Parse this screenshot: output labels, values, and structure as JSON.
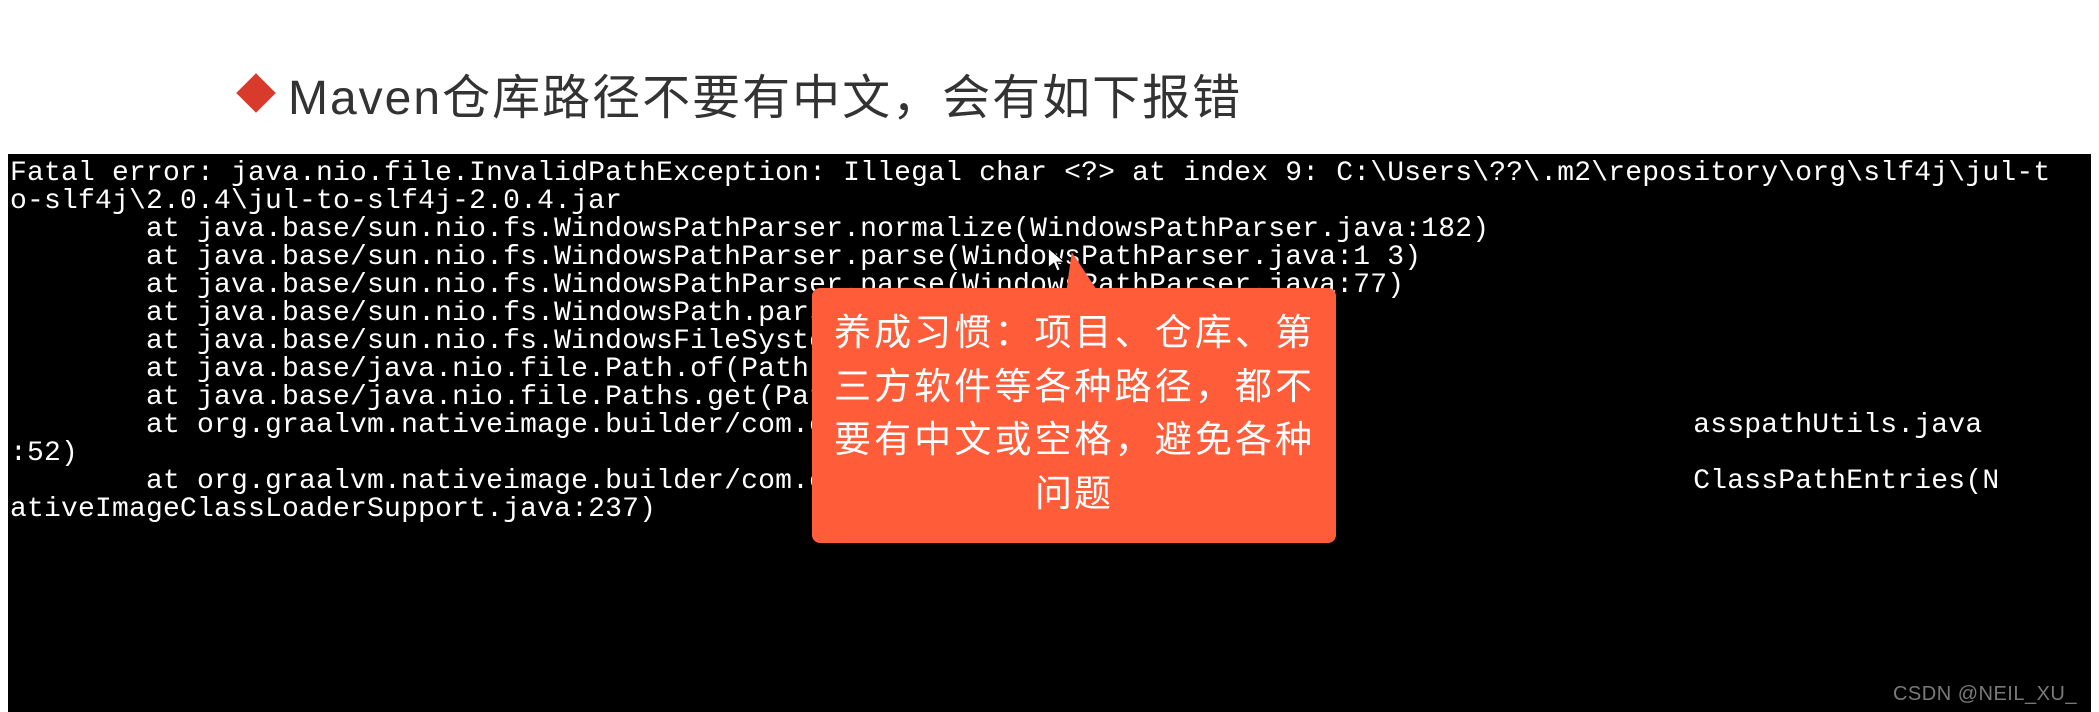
{
  "heading": "Maven仓库路径不要有中文，会有如下报错",
  "terminal": {
    "lines": [
      "Fatal error: java.nio.file.InvalidPathException: Illegal char <?> at index 9: C:\\Users\\??\\.m2\\repository\\org\\slf4j\\jul-t",
      "o-slf4j\\2.0.4\\jul-to-slf4j-2.0.4.jar",
      "        at java.base/sun.nio.fs.WindowsPathParser.normalize(WindowsPathParser.java:182)",
      "        at java.base/sun.nio.fs.WindowsPathParser.parse(WindowsPathParser.java:1 3)",
      "        at java.base/sun.nio.fs.WindowsPathParser.parse(WindowsPathParser.java:77)",
      "        at java.base/sun.nio.fs.WindowsPath.parse(WindowsPath.",
      "        at java.base/sun.nio.fs.WindowsFileSystem.getPath(Wind",
      "        at java.base/java.nio.file.Path.of(Path.java:147)",
      "        at java.base/java.nio.file.Paths.get(Paths.java:69)",
      "        at org.graalvm.nativeimage.builder/com.oracle.svm.core                                     asspathUtils.java",
      ":52)",
      "        at org.graalvm.nativeimage.builder/com.oracle.svm.host                                     ClassPathEntries(N",
      "ativeImageClassLoaderSupport.java:237)"
    ]
  },
  "callout": "养成习惯：项目、仓库、第三方软件等各种路径，都不要有中文或空格，避免各种问题",
  "watermark": "CSDN @NEIL_XU_"
}
